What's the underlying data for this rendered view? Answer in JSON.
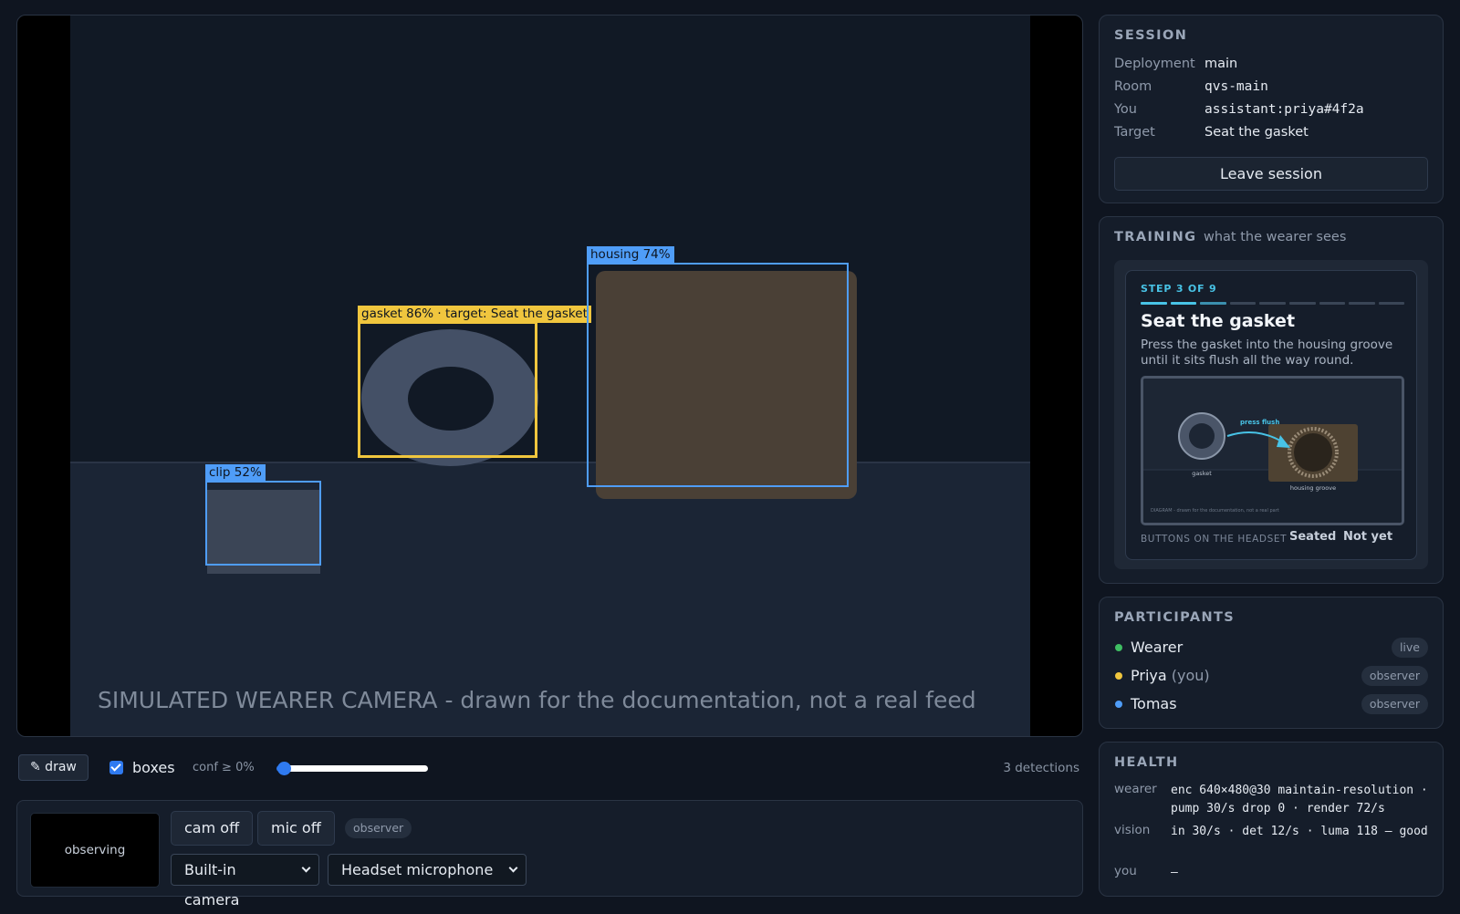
{
  "video": {
    "caption": "SIMULATED WEARER CAMERA - drawn for the documentation, not a real feed",
    "detections": [
      {
        "label": "gasket 86% · target: Seat the gasket",
        "class": "gasket",
        "confidence": 0.86,
        "is_target": true
      },
      {
        "label": "housing 74%",
        "class": "housing",
        "confidence": 0.74,
        "is_target": false
      },
      {
        "label": "clip 52%",
        "class": "clip",
        "confidence": 0.52,
        "is_target": false
      }
    ]
  },
  "toolbar": {
    "draw_label": "✎ draw",
    "boxes_label": "boxes",
    "boxes_checked": true,
    "conf_label": "conf ≥ 0%",
    "conf_value": 0,
    "detection_count": "3 detections"
  },
  "local": {
    "preview_text": "observing",
    "cam_button": "cam off",
    "mic_button": "mic off",
    "role_pill": "observer",
    "camera_select": "Built-in camera",
    "mic_select": "Headset microphone"
  },
  "session": {
    "title": "SESSION",
    "rows": [
      {
        "key": "Deployment",
        "value": "main"
      },
      {
        "key": "Room",
        "value": "qvs-main"
      },
      {
        "key": "You",
        "value": "assistant:priya#4f2a"
      },
      {
        "key": "Target",
        "value": "Seat the gasket"
      }
    ],
    "leave_button": "Leave session"
  },
  "training": {
    "title": "TRAINING",
    "subtitle": "what the wearer sees",
    "step_counter": "STEP 3 OF 9",
    "current_step": 3,
    "total_steps": 9,
    "step_title": "Seat the gasket",
    "step_body": "Press the gasket into the housing groove until it sits flush all the way round.",
    "diagram": {
      "arrow_label": "press flush",
      "left_label": "gasket",
      "right_label": "housing groove",
      "footer": "DIAGRAM - drawn for the documentation, not a real part"
    },
    "headset_label": "BUTTONS ON THE HEADSET",
    "headset_buttons": [
      "Seated",
      "Not yet"
    ]
  },
  "participants": {
    "title": "PARTICIPANTS",
    "list": [
      {
        "name": "Wearer",
        "suffix": "",
        "role": "live",
        "color": "#3fbf63"
      },
      {
        "name": "Priya",
        "suffix": " (you)",
        "role": "observer",
        "color": "#f0c63e"
      },
      {
        "name": "Tomas",
        "suffix": "",
        "role": "observer",
        "color": "#4f9df8"
      }
    ]
  },
  "health": {
    "title": "HEALTH",
    "rows": [
      {
        "key": "wearer",
        "value": "enc 640×480@30 maintain-resolution · pump 30/s drop 0 · render 72/s"
      },
      {
        "key": "vision",
        "value": "in 30/s · det 12/s · luma 118 — good"
      },
      {
        "key": "you",
        "value": "—"
      }
    ]
  }
}
